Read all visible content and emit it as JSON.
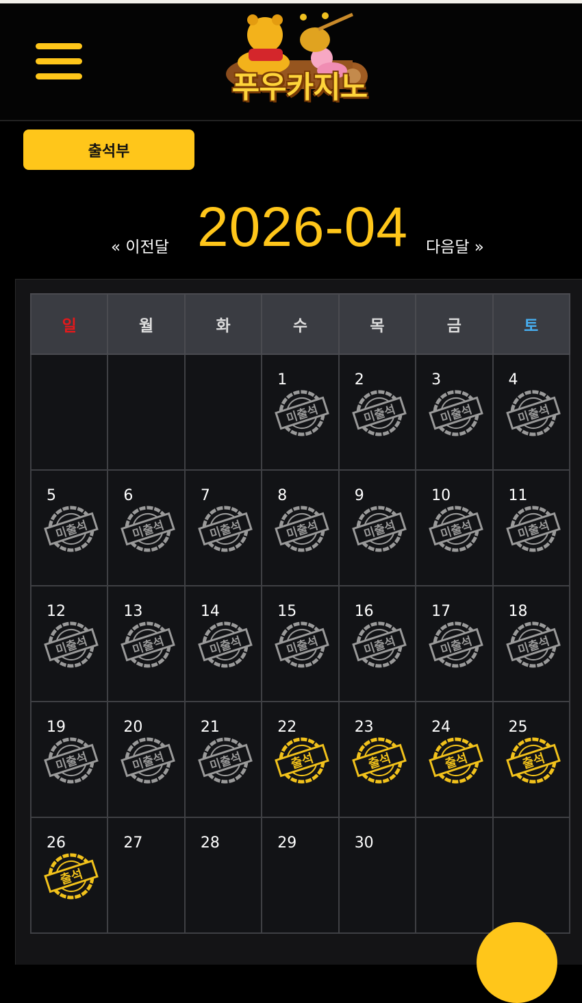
{
  "header": {
    "menu_icon": "hamburger-menu-icon",
    "logo_text": "푸우카지노",
    "accent_color": "#ffc61a"
  },
  "tabs": {
    "attendance_label": "출석부"
  },
  "month_nav": {
    "prev_label": "« 이전달",
    "current_month": "2026-04",
    "next_label": "다음달 »"
  },
  "calendar": {
    "weekdays": [
      "일",
      "월",
      "화",
      "수",
      "목",
      "금",
      "토"
    ],
    "stamp_labels": {
      "absent": "미출석",
      "present": "출석"
    },
    "weeks": [
      [
        null,
        null,
        null,
        {
          "day": "1",
          "status": "absent"
        },
        {
          "day": "2",
          "status": "absent"
        },
        {
          "day": "3",
          "status": "absent"
        },
        {
          "day": "4",
          "status": "absent"
        }
      ],
      [
        {
          "day": "5",
          "status": "absent"
        },
        {
          "day": "6",
          "status": "absent"
        },
        {
          "day": "7",
          "status": "absent"
        },
        {
          "day": "8",
          "status": "absent"
        },
        {
          "day": "9",
          "status": "absent"
        },
        {
          "day": "10",
          "status": "absent"
        },
        {
          "day": "11",
          "status": "absent"
        }
      ],
      [
        {
          "day": "12",
          "status": "absent"
        },
        {
          "day": "13",
          "status": "absent"
        },
        {
          "day": "14",
          "status": "absent"
        },
        {
          "day": "15",
          "status": "absent"
        },
        {
          "day": "16",
          "status": "absent"
        },
        {
          "day": "17",
          "status": "absent"
        },
        {
          "day": "18",
          "status": "absent"
        }
      ],
      [
        {
          "day": "19",
          "status": "absent"
        },
        {
          "day": "20",
          "status": "absent"
        },
        {
          "day": "21",
          "status": "absent"
        },
        {
          "day": "22",
          "status": "present"
        },
        {
          "day": "23",
          "status": "present"
        },
        {
          "day": "24",
          "status": "present"
        },
        {
          "day": "25",
          "status": "present"
        }
      ],
      [
        {
          "day": "26",
          "status": "present"
        },
        {
          "day": "27",
          "status": "none"
        },
        {
          "day": "28",
          "status": "none"
        },
        {
          "day": "29",
          "status": "none"
        },
        {
          "day": "30",
          "status": "none"
        },
        null,
        null
      ]
    ],
    "colors": {
      "sunday": "#e4191b",
      "saturday": "#47aef0",
      "absent_stamp": "#9a9a9a",
      "present_stamp": "#f2c21b"
    }
  }
}
